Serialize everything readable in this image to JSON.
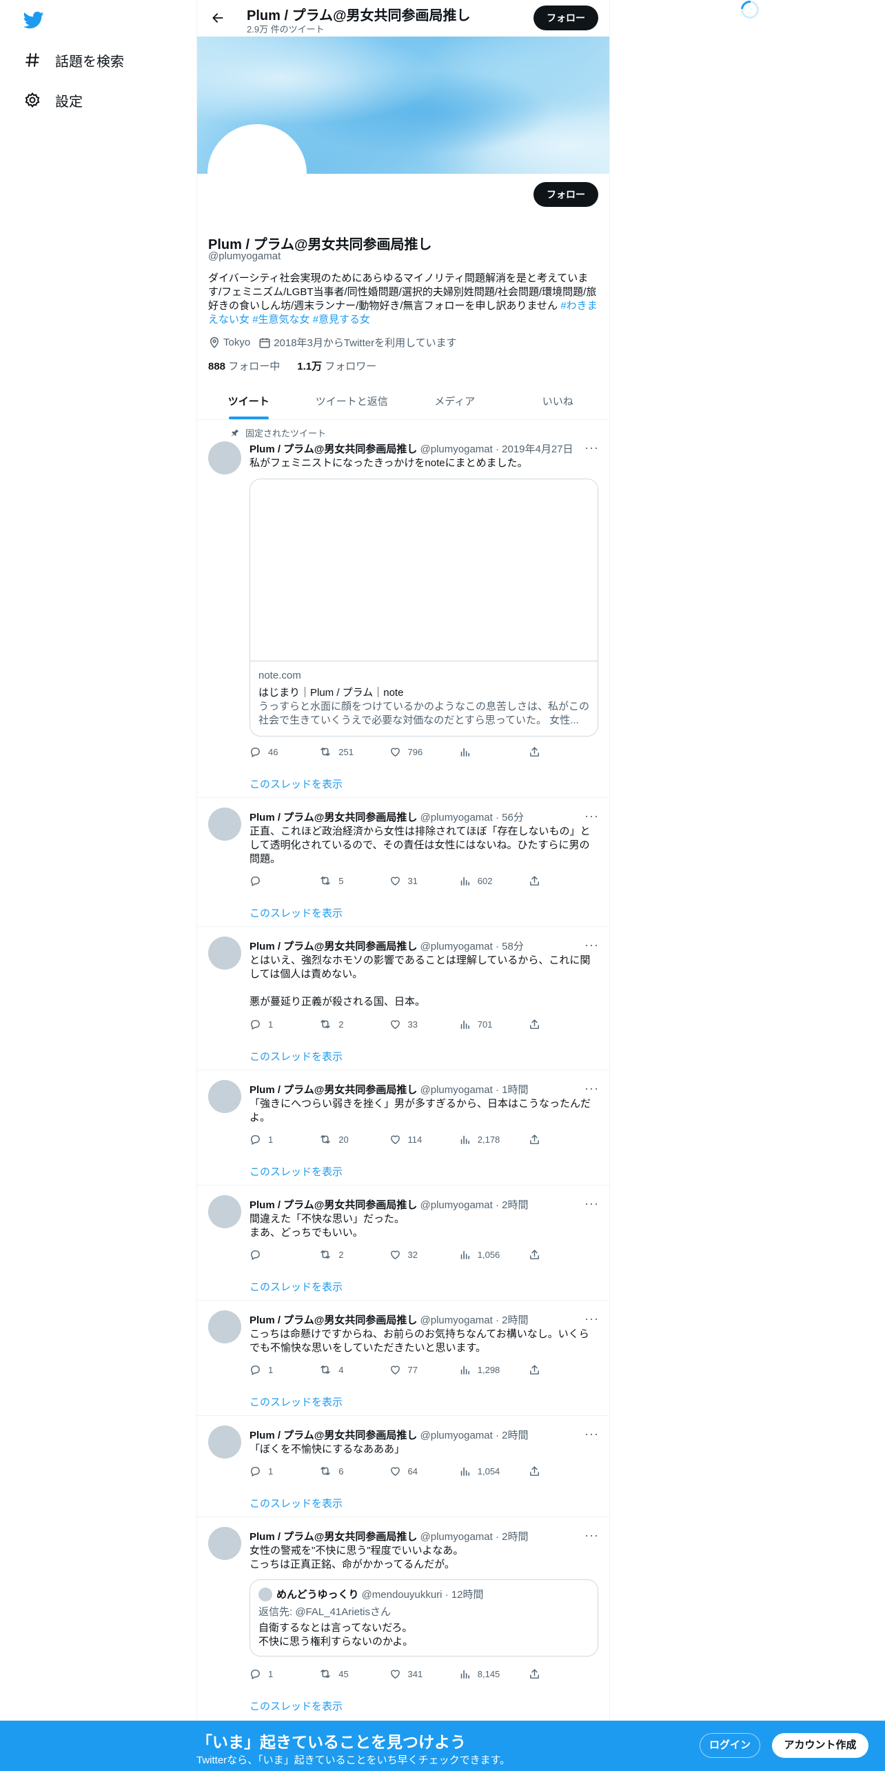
{
  "sidebar": {
    "items": [
      {
        "label": "話題を検索",
        "icon": "hash-icon"
      },
      {
        "label": "設定",
        "icon": "gear-icon"
      }
    ]
  },
  "header": {
    "title": "Plum / プラム@男女共同参画局推し",
    "tweet_count": "2.9万 件のツイート",
    "follow_label": "フォロー"
  },
  "profile": {
    "follow_label": "フォロー",
    "name": "Plum / プラム@男女共同参画局推し",
    "handle": "@plumyogamat",
    "bio": "ダイバーシティ社会実現のためにあらゆるマイノリティ問題解消を是と考えています/フェミニズム/LGBT当事者/同性婚問題/選択的夫婦別姓問題/社会問題/環境問題/旅好きの食いしん坊/週末ランナー/動物好き/無言フォローを申し訳ありません",
    "hashtags": [
      "#わきまえない女",
      "#生意気な女",
      "#意見する女"
    ],
    "location": "Tokyo",
    "joined": "2018年3月からTwitterを利用しています",
    "following_count": "888",
    "following_label": "フォロー中",
    "followers_count": "1.1万",
    "followers_label": "フォロワー"
  },
  "tabs": [
    {
      "label": "ツイート",
      "active": true
    },
    {
      "label": "ツイートと返信",
      "active": false
    },
    {
      "label": "メディア",
      "active": false
    },
    {
      "label": "いいね",
      "active": false
    }
  ],
  "show_thread_label": "このスレッドを表示",
  "tweets": [
    {
      "pinned_label": "固定されたツイート",
      "name": "Plum / プラム@男女共同参画局推し",
      "meta": "@plumyogamat · 2019年4月27日",
      "body": "私がフェミニストになったきっかけをnoteにまとめました。",
      "card": {
        "domain": "note.com",
        "title": "はじまり｜Plum / プラム｜note",
        "description": "うっすらと水面に顔をつけているかのようなこの息苦しさは、私がこの社会で生きていくうえで必要な対価なのだとすら思っていた。 女性..."
      },
      "replies": "46",
      "retweets": "251",
      "likes": "796",
      "views": ""
    },
    {
      "name": "Plum / プラム@男女共同参画局推し",
      "meta": "@plumyogamat · 56分",
      "body": "正直、これほど政治経済から女性は排除されてほぼ「存在しないもの」として透明化されているので、その責任は女性にはないね。ひたすらに男の問題。",
      "replies": "",
      "retweets": "5",
      "likes": "31",
      "views": "602"
    },
    {
      "name": "Plum / プラム@男女共同参画局推し",
      "meta": "@plumyogamat · 58分",
      "body": "とはいえ、強烈なホモソの影響であることは理解しているから、これに関しては個人は責めない。\n\n悪が蔓延り正義が殺される国、日本。",
      "replies": "1",
      "retweets": "2",
      "likes": "33",
      "views": "701"
    },
    {
      "name": "Plum / プラム@男女共同参画局推し",
      "meta": "@plumyogamat · 1時間",
      "body": "「強きにへつらい弱きを挫く」男が多すぎるから、日本はこうなったんだよ。",
      "replies": "1",
      "retweets": "20",
      "likes": "114",
      "views": "2,178"
    },
    {
      "name": "Plum / プラム@男女共同参画局推し",
      "meta": "@plumyogamat · 2時間",
      "body": "間違えた「不快な思い」だった。\nまあ、どっちでもいい。",
      "replies": "",
      "retweets": "2",
      "likes": "32",
      "views": "1,056"
    },
    {
      "name": "Plum / プラム@男女共同参画局推し",
      "meta": "@plumyogamat · 2時間",
      "body": "こっちは命懸けですからね、お前らのお気持ちなんてお構いなし。いくらでも不愉快な思いをしていただきたいと思います。",
      "replies": "1",
      "retweets": "4",
      "likes": "77",
      "views": "1,298"
    },
    {
      "name": "Plum / プラム@男女共同参画局推し",
      "meta": "@plumyogamat · 2時間",
      "body": "「ぼくを不愉快にするなあああ」",
      "replies": "1",
      "retweets": "6",
      "likes": "64",
      "views": "1,054"
    },
    {
      "name": "Plum / プラム@男女共同参画局推し",
      "meta": "@plumyogamat · 2時間",
      "body": "女性の警戒を\"不快に思う\"程度でいいよなあ。\nこっちは正真正銘、命がかかってるんだが。",
      "quote": {
        "name": "めんどうゆっくり",
        "meta": "@mendouyukkuri · 12時間",
        "reply_to": "返信先: @FAL_41Arietisさん",
        "body": "自衛するなとは言ってないだろ。\n不快に思う権利すらないのかよ。"
      },
      "replies": "1",
      "retweets": "45",
      "likes": "341",
      "views": "8,145"
    }
  ],
  "bottom_bar": {
    "title": "「いま」起きていることを見つけよう",
    "subtitle": "Twitterなら、「いま」起きていることをいち早くチェックできます。",
    "login_label": "ログイン",
    "signup_label": "アカウント作成"
  },
  "colors": {
    "accent": "#1d9bf0",
    "text": "#0f1419",
    "muted": "#536471",
    "border": "#eff3f4"
  }
}
